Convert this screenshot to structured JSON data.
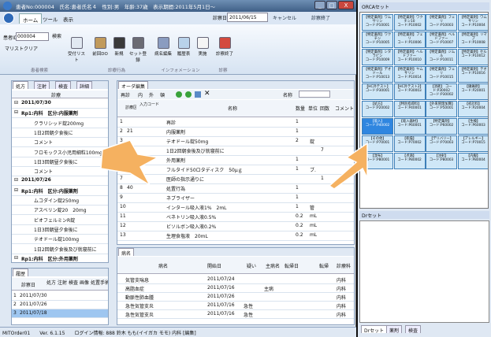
{
  "window": {
    "title": "患者No:000004　氏名:患者氏名４　性別:男　年齢:37歳　表示期間:2011年5月1日〜",
    "btn_min": "_",
    "btn_max": "□",
    "btn_close": "X"
  },
  "ribbon": {
    "tabs": [
      "ホーム",
      "ツール",
      "表示"
    ],
    "patient_no_label": "患者ID",
    "patient_no": "000004",
    "clear": "マリストクリア",
    "search": "検索",
    "buttons": [
      "受付リスト",
      "前回DO",
      "新規",
      "セット登録",
      "病名編集",
      "履歴表",
      "実施",
      "診察終了"
    ],
    "groups": [
      "患者検索",
      "診療行為",
      "インフォメーション",
      "診察"
    ],
    "date_label": "診察日",
    "date": "2011/06/15",
    "cancel": "キャンセル",
    "save": "診察終了"
  },
  "left": {
    "tabs": [
      "処方",
      "注射",
      "検査",
      "詳細"
    ],
    "header": "診療",
    "rows": [
      [
        "⊟",
        "2011/07/30"
      ],
      [
        "⊟",
        "Rp1:内科　区分:内服薬剤"
      ],
      [
        "",
        "クラリシッド錠200mg"
      ],
      [
        "",
        "1日2回朝夕食後に"
      ],
      [
        "",
        "コメント"
      ],
      [
        "",
        "フロモックス小児用細粒100mg"
      ],
      [
        "",
        "1日3回朝昼夕食後に"
      ],
      [
        "",
        "コメント"
      ],
      [
        "⊟",
        "2011/07/26"
      ],
      [
        "⊟",
        "Rp1:内科　区分:内服薬剤"
      ],
      [
        "",
        "ムコダイン錠250mg"
      ],
      [
        "",
        "アスベリン錠20　20mg"
      ],
      [
        "",
        "ビオフェルミンR錠"
      ],
      [
        "",
        "1日3回朝昼夕食後に"
      ],
      [
        "",
        "テオドール錠100mg"
      ],
      [
        "",
        "1日2回朝夕食後及び就寝前に"
      ],
      [
        "⊟",
        "Rp1:内科　区分:外用薬剤"
      ]
    ]
  },
  "history": {
    "title": "履歴",
    "headers": [
      "診察日",
      "処方",
      "注射",
      "検査",
      "画像",
      "処置",
      "手術"
    ],
    "rows": [
      [
        "1",
        "2011/07/30"
      ],
      [
        "2",
        "2011/07/26"
      ],
      [
        "3",
        "2011/07/18"
      ]
    ]
  },
  "order": {
    "title": "オーダ編集",
    "toolbar": [
      "再診",
      "内",
      "外",
      "頓"
    ],
    "name_label": "名称",
    "headers": [
      "診療区分",
      "入力コード",
      "名称",
      "数量",
      "単位",
      "回数",
      "コメント"
    ],
    "rows": [
      [
        "1",
        "",
        "再診",
        "1",
        "",
        ""
      ],
      [
        "2",
        "21",
        "内服薬剤",
        "1",
        "",
        ""
      ],
      [
        "3",
        "",
        "テオドール錠50mg",
        "2",
        "錠",
        ""
      ],
      [
        "4",
        "",
        "1日2回朝食後及び就寝前に",
        "",
        "",
        "7"
      ],
      [
        "5",
        "",
        "外用薬剤",
        "1",
        "",
        ""
      ],
      [
        "6",
        "",
        "フルタイド50ロタディスク　50μｇ",
        "1",
        "ブ.",
        ""
      ],
      [
        "7",
        "",
        "医師の指示通りに",
        "",
        "",
        "1"
      ],
      [
        "8",
        "40",
        "処置行為",
        "1",
        "",
        ""
      ],
      [
        "9",
        "",
        "ネブライザー",
        "1",
        "",
        ""
      ],
      [
        "10",
        "",
        "インタール吸入液1%　2mL",
        "1",
        "管",
        ""
      ],
      [
        "11",
        "",
        "ベネトリン吸入液0.5%",
        "0.2",
        "mL",
        ""
      ],
      [
        "12",
        "",
        "ビソルボン吸入液0.2%",
        "0.2",
        "mL",
        ""
      ],
      [
        "13",
        "",
        "生理食塩液　20mL",
        "0.2",
        "mL",
        ""
      ]
    ]
  },
  "disease": {
    "title": "病名",
    "headers": [
      "病名",
      "開始日",
      "疑い",
      "主病名",
      "転帰日",
      "転帰",
      "診療科"
    ],
    "rows": [
      [
        "気管支喘息",
        "2011/07/24",
        "",
        "",
        "",
        "",
        "内科"
      ],
      [
        "高脂血症",
        "2011/07/16",
        "",
        "主病",
        "",
        "",
        "内科"
      ],
      [
        "動脈性肺血腫",
        "2011/07/26",
        "",
        "",
        "",
        "",
        "内科"
      ],
      [
        "急性気管支炎",
        "2011/07/16",
        "急性",
        "",
        "",
        "",
        "内科"
      ],
      [
        "急性気管支炎",
        "2011/07/16",
        "急性",
        "",
        "",
        "",
        "内科"
      ]
    ]
  },
  "orca": {
    "title": "ORCAセット",
    "cells": [
      "【特定薬剤】ワムサリン",
      "【特定薬剤】ワクチン10",
      "【特定薬剤】フェリ",
      "【特定薬剤】ワムサリン",
      "【特定薬剤】ワクチン",
      "【特定薬剤】フェリ",
      "【特定薬剤】ベルドファー",
      "【特定薬剤】リマプ",
      "【特定薬剤】シタラビン",
      "【特定薬剤】ヘルドファー",
      "【特定薬剤】ジムル",
      "【特定薬剤】セル",
      "【特定薬剤】デオドール",
      "【特定薬剤】ヤムサリン",
      "【特定薬剤】フェリ",
      "【特定薬剤】テオ",
      "【HC外テスト】",
      "【HC外テスト2】",
      "【消耗】 コード:P30002",
      "【鎮痛剤】",
      "【処方】",
      "【特別指導料】",
      "【外来管理加算】",
      "【初診料】",
      "【吸入】",
      "【吸入器材】",
      "【特定薬剤】",
      "【生検】",
      "【その他】",
      "【乾燥】",
      "【デリバリー】",
      "【アレルギー】",
      "【湿布】",
      "【点滴】",
      "【注射】",
      "【内服】"
    ],
    "codes": [
      "コード:P10001",
      "コード:P10002",
      "コード:P10003",
      "コード:P10004",
      "コード:P10005",
      "コード:P10006",
      "コード:P10007",
      "コード:P10008",
      "コード:P10009",
      "コード:P10010",
      "コード:P10011",
      "コード:P10012",
      "コード:P10013",
      "コード:P10014",
      "コード:P10015",
      "コード:P10016",
      "コード:P30001",
      "コード:P30003",
      "コード:P30002",
      "コード:P20001",
      "コード:P20002",
      "コード:P40001",
      "コード:P50001",
      "コード:P20004",
      "コード:P40002",
      "コード:P60001",
      "コード:P60002",
      "コード:P60003",
      "コード:P70001",
      "コード:P70002",
      "コード:P70003",
      "コード:P70015",
      "コード:P80001",
      "コード:P80002",
      "コード:P80003",
      "コード:P80004"
    ]
  },
  "dr": {
    "title": "Drセット",
    "tabs": [
      "Drセット",
      "薬剤",
      "検査"
    ]
  },
  "status": {
    "text": "MITOrder01　　Ver. 6.1.15　　ログイン情報: 888 鈴木 もも(イイガカ モモ) 内科 [編集]"
  },
  "colors": {
    "accent": "#2f86e0",
    "cell": "#cfe7f7",
    "arrow": "#f5b160"
  }
}
